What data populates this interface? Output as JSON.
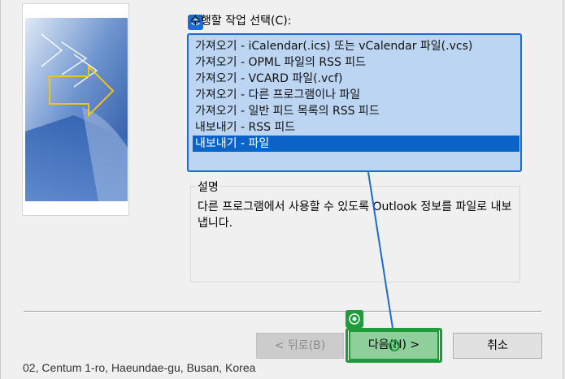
{
  "background": {
    "obscured_text": "02, Centum 1-ro, Haeundae-gu, Busan, Korea"
  },
  "wizard": {
    "list_label": "수행할 작업 선택(C):",
    "actions": [
      "가져오기 - iCalendar(.ics) 또는 vCalendar 파일(.vcs)",
      "가져오기 - OPML 파일의 RSS 피드",
      "가져오기 - VCARD 파일(.vcf)",
      "가져오기 - 다른 프로그램이나 파일",
      "가져오기 - 일반 피드 목록의 RSS 피드",
      "내보내기 - RSS 피드",
      "내보내기 - 파일"
    ],
    "selected_index": 6,
    "description_title": "설명",
    "description_text": "다른 프로그램에서 사용할 수 있도록 Outlook 정보를 파일로 내보냅니다.",
    "buttons": {
      "back": "< 뒤로(B)",
      "next": "다음(N) >",
      "cancel": "취소"
    }
  },
  "annotation": {
    "source_icon": "anchor-icon",
    "target_icon": "target-icon",
    "source_color": "#1a6bd4",
    "target_color": "#1f9c3a"
  }
}
